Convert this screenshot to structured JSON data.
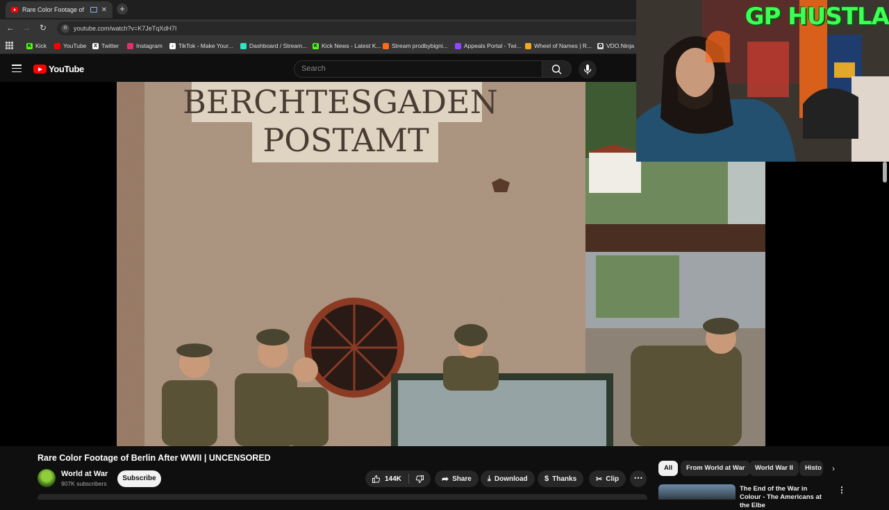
{
  "browser": {
    "tab_title": "Rare Color Footage of Berlin",
    "tab_close": "✕",
    "newtab": "+",
    "url": "youtube.com/watch?v=K7JeTqXdH7I",
    "bookmarks": [
      {
        "label": "Kick",
        "icon": "kick-icon",
        "color": "#53fc18",
        "glyph": "K"
      },
      {
        "label": "YouTube",
        "icon": "youtube-icon",
        "color": "#ff0000",
        "glyph": ""
      },
      {
        "label": "Twitter",
        "icon": "x-icon",
        "color": "#ffffff",
        "glyph": "X"
      },
      {
        "label": "Instagram",
        "icon": "instagram-icon",
        "color": "#e1306c",
        "glyph": ""
      },
      {
        "label": "TikTok - Make Your...",
        "icon": "tiktok-icon",
        "color": "#ffffff",
        "glyph": "♪"
      },
      {
        "label": "Dashboard / Stream...",
        "icon": "dashboard-icon",
        "color": "#2ee6c4",
        "glyph": ""
      },
      {
        "label": "Kick News - Latest K...",
        "icon": "kick-news-icon",
        "color": "#53fc18",
        "glyph": "K"
      },
      {
        "label": "Stream prodbybigni...",
        "icon": "stream-icon",
        "color": "#ff6a1a",
        "glyph": ""
      },
      {
        "label": "Appeals Portal - Twi...",
        "icon": "twitch-icon",
        "color": "#9146ff",
        "glyph": ""
      },
      {
        "label": "Wheel of Names | R...",
        "icon": "wheel-icon",
        "color": "#f5a623",
        "glyph": ""
      },
      {
        "label": "VDO.Ninja",
        "icon": "vdo-ninja-icon",
        "color": "#dddddd",
        "glyph": "✿"
      }
    ]
  },
  "youtube": {
    "logo_text": "YouTube",
    "search_placeholder": "Search"
  },
  "webcam": {
    "title": "GP HUSTLA"
  },
  "video_frame": {
    "sign_line1": "BERCHTESGADEN",
    "sign_line2": "POSTAMT"
  },
  "video": {
    "title": "Rare Color Footage of Berlin After WWII | UNCENSORED",
    "channel": "World at War",
    "subscribers": "907K subscribers",
    "subscribe_label": "Subscribe",
    "likes": "144K",
    "share_label": "Share",
    "download_label": "Download",
    "thanks_label": "Thanks",
    "clip_label": "Clip",
    "more_label": "⋯"
  },
  "sidebar": {
    "chips": [
      "All",
      "From World at War",
      "World War II",
      "Histo"
    ],
    "rec_title": "The End of the War in Colour - The Americans at the Elbe",
    "rec_menu": "⋮"
  },
  "colors": {
    "youtube_red": "#ff0000",
    "background": "#0f0f0f",
    "overlay_green": "#3dff55"
  }
}
